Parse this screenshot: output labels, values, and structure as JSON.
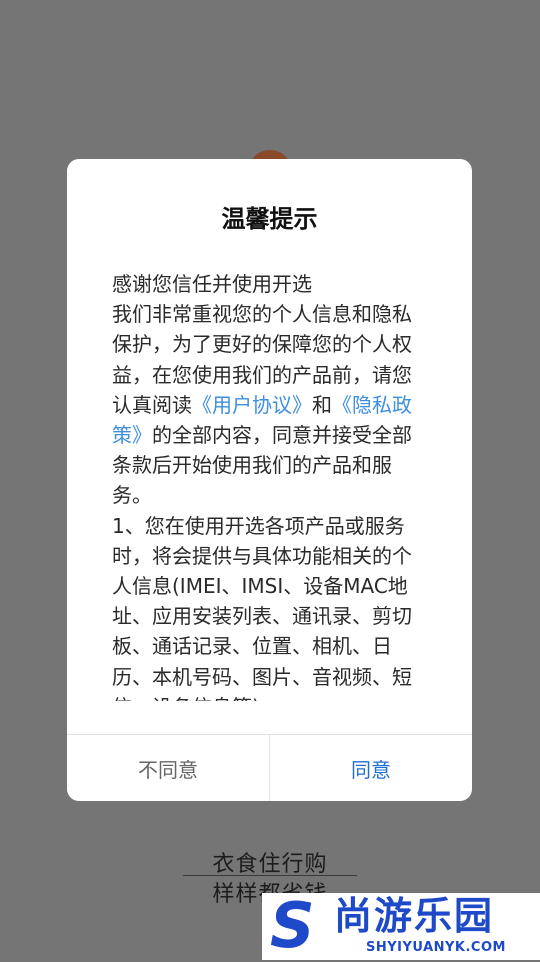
{
  "background": {
    "slogan_line1": "衣食住行购",
    "slogan_line2": "样样都省钱"
  },
  "watermark": {
    "letter": "S",
    "name": "尚游乐园",
    "url": "SHYIYUANYK.COM"
  },
  "dialog": {
    "title": "温馨提示",
    "intro_line1": "感谢您信任并使用开选",
    "para_before": "我们非常重视您的个人信息和隐私保护，为了更好的保障您的个人权益，在您使用我们的产品前，请您认真阅读",
    "link_user_agreement": "《用户协议》",
    "and_text": "和",
    "link_privacy_policy": "《隐私政策》",
    "para_after": "的全部内容，同意并接受全部条款后开始使用我们的产品和服务。",
    "clause1": "1、您在使用开选各项产品或服务时，将会提供与具体功能相关的个人信息(IMEI、IMSI、设备MAC地址、应用安装列表、通讯录、剪切板、通话记录、位置、相机、日历、本机号码、图片、音视频、短信、设备信息等)",
    "disagree_label": "不同意",
    "agree_label": "同意"
  },
  "colors": {
    "overlay_background": "#757575",
    "link": "#3d8fe0",
    "agree_button": "#1f6fd6",
    "watermark_brand": "#1e49c8"
  }
}
